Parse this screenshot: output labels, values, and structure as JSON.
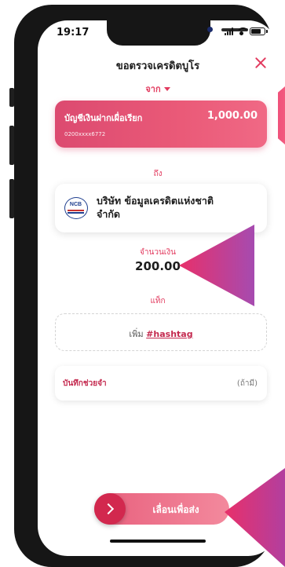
{
  "status_bar": {
    "time": "19:17"
  },
  "header": {
    "title": "ขอตรวจเครดิตบูโร"
  },
  "source": {
    "label": "จาก",
    "account": {
      "name": "บัญชีเงินฝากเผื่อเรียก",
      "balance": "1,000.00",
      "number": "0200xxxx6772"
    }
  },
  "destination": {
    "label": "ถึง",
    "logo_text": "NCB",
    "name": "บริษัท ข้อมูลเครดิตแห่งชาติ จำกัด"
  },
  "amount": {
    "label": "จำนวนเงิน",
    "value": "200.00"
  },
  "tag": {
    "label": "แท็ก",
    "add_prefix": "เพิ่ม",
    "hashtag": "#hashtag"
  },
  "memo": {
    "label": "บันทึกช่วยจำ",
    "placeholder": "(ถ้ามี)"
  },
  "action": {
    "slide_label": "เลื่อนเพื่อส่ง"
  },
  "colors": {
    "accent": "#e23a5e",
    "card_gradient_start": "#dc4a70",
    "card_gradient_end": "#f06985",
    "knob": "#d2284e"
  }
}
